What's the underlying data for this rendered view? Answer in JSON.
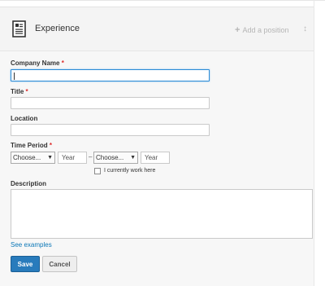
{
  "section": {
    "title": "Experience",
    "add_position": "Add a position"
  },
  "form": {
    "company_name": {
      "label": "Company Name",
      "required_mark": "*",
      "value": ""
    },
    "title": {
      "label": "Title",
      "required_mark": "*",
      "value": ""
    },
    "location": {
      "label": "Location",
      "value": ""
    },
    "time_period": {
      "label": "Time Period",
      "required_mark": "*",
      "start_month": "Choose...",
      "start_year_placeholder": "Year",
      "separator": "–",
      "end_month": "Choose...",
      "end_year_placeholder": "Year",
      "current_checkbox_label": "I currently work here",
      "current_checked": false
    },
    "description": {
      "label": "Description",
      "value": ""
    },
    "see_examples": "See examples",
    "save_label": "Save",
    "cancel_label": "Cancel"
  },
  "icons": {
    "section": "document-icon",
    "add": "plus-icon",
    "reorder": "reorder-icon",
    "dropdown": "chevron-down-icon"
  },
  "colors": {
    "primary_button": "#287bbc",
    "link": "#0b77b7",
    "required": "#dd2b2b",
    "focus_border": "#2b8bd6"
  }
}
